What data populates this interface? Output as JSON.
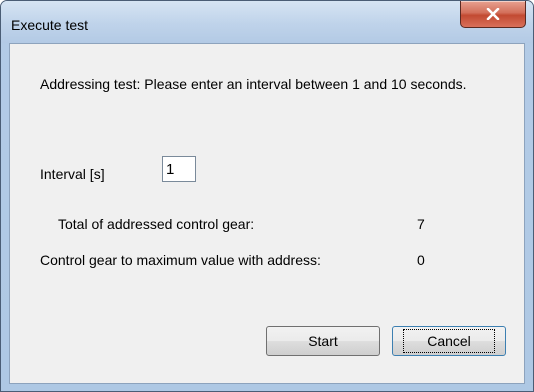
{
  "window": {
    "title": "Execute test",
    "close_icon": "close-x-icon"
  },
  "dialog": {
    "message": "Addressing test: Please enter an interval between 1 and 10 seconds.",
    "interval_label": "Interval [s]",
    "interval_value": "1",
    "total_label": "Total of addressed control gear:",
    "total_value": "7",
    "max_label": "Control gear to maximum value with address:",
    "max_value": "0"
  },
  "buttons": {
    "start_label": "Start",
    "cancel_label": "Cancel"
  },
  "colors": {
    "close_button": "#c24a32",
    "frame": "#b3cbe6",
    "client_bg": "#f0f0f0"
  }
}
